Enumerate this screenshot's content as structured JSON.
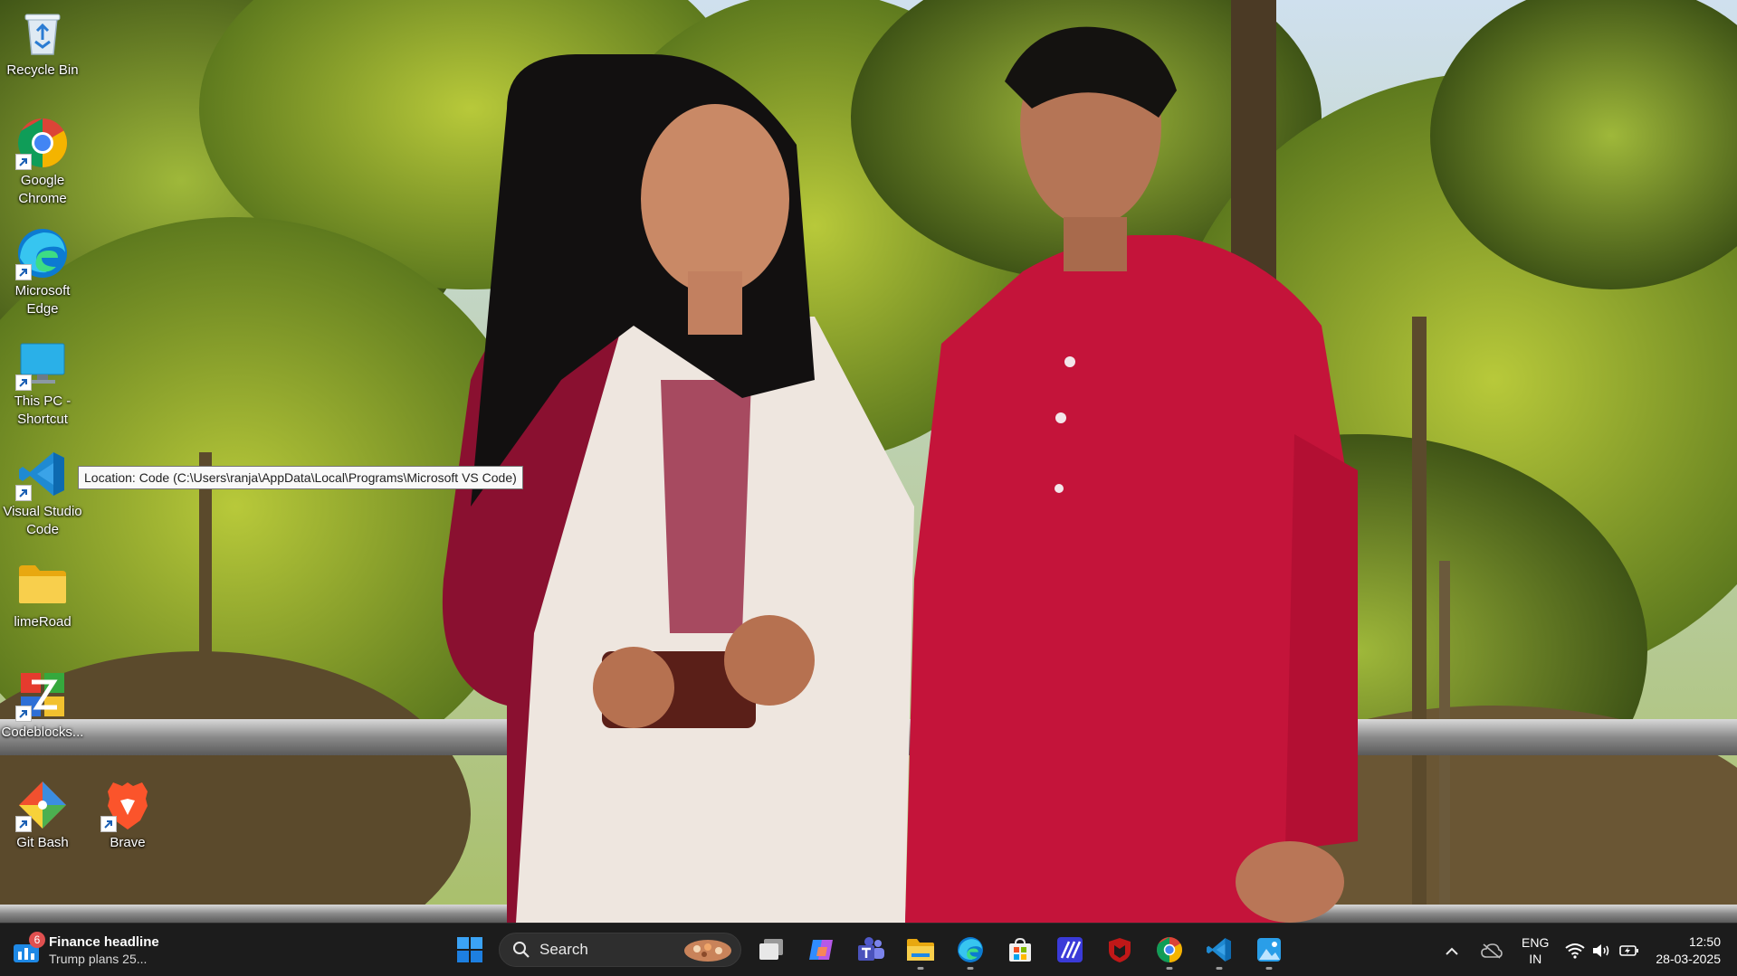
{
  "desktop": {
    "icons": [
      {
        "label": "Recycle Bin",
        "icon": "recycle-bin-icon"
      },
      {
        "label": "Google Chrome",
        "icon": "chrome-icon"
      },
      {
        "label": "Microsoft Edge",
        "icon": "edge-icon"
      },
      {
        "label": "This PC - Shortcut",
        "icon": "this-pc-icon"
      },
      {
        "label": "Visual Studio Code",
        "icon": "vscode-icon"
      },
      {
        "label": "limeRoad",
        "icon": "folder-icon"
      },
      {
        "label": "Codeblocks...",
        "icon": "codeblocks-icon"
      },
      {
        "label": "Git Bash",
        "icon": "git-bash-icon"
      },
      {
        "label": "Brave",
        "icon": "brave-icon"
      }
    ],
    "tooltip": "Location: Code (C:\\Users\\ranja\\AppData\\Local\\Programs\\Microsoft VS Code)"
  },
  "taskbar": {
    "widget": {
      "badge": "6",
      "title": "Finance headline",
      "subtitle": "Trump plans 25..."
    },
    "search": {
      "label": "Search"
    },
    "apps": [
      {
        "name": "start",
        "icon": "windows-start-icon"
      },
      {
        "name": "task-view",
        "icon": "task-view-icon"
      },
      {
        "name": "copilot",
        "icon": "copilot-icon"
      },
      {
        "name": "teams",
        "icon": "teams-icon"
      },
      {
        "name": "file-explorer",
        "icon": "file-explorer-icon"
      },
      {
        "name": "edge",
        "icon": "edge-icon"
      },
      {
        "name": "microsoft-store",
        "icon": "store-icon"
      },
      {
        "name": "power-automate",
        "icon": "power-automate-icon"
      },
      {
        "name": "mcafee",
        "icon": "mcafee-icon"
      },
      {
        "name": "chrome",
        "icon": "chrome-icon"
      },
      {
        "name": "vscode",
        "icon": "vscode-icon"
      },
      {
        "name": "photos",
        "icon": "photos-icon"
      }
    ],
    "tray": {
      "language_primary": "ENG",
      "language_secondary": "IN",
      "time": "12:50",
      "date": "28-03-2025"
    }
  },
  "colors": {
    "taskbar_bg": "#1c1c1c",
    "accent_blue": "#0078d4",
    "kurta_red": "#c4143a",
    "foliage": "#8aa82a"
  }
}
